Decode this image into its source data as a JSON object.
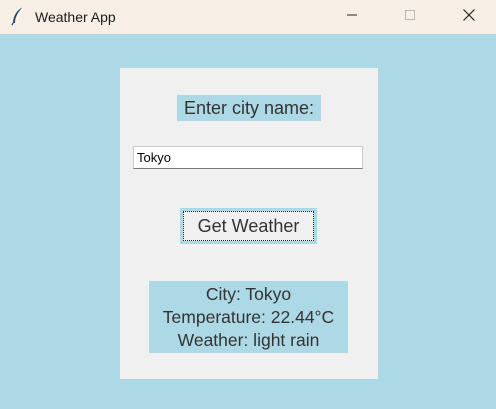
{
  "window": {
    "title": "Weather App",
    "icons": {
      "app": "feather-icon",
      "minimize": "minimize-icon",
      "maximize": "maximize-icon",
      "close": "close-icon"
    }
  },
  "form": {
    "city_label": "Enter city name:",
    "city_value": "Tokyo",
    "button_label": "Get Weather"
  },
  "result": {
    "city_line": "City: Tokyo",
    "temperature_line": "Temperature: 22.44°C",
    "weather_line": "Weather: light rain"
  },
  "colors": {
    "background": "#add8e6",
    "panel": "#f0f0f0",
    "titlebar": "#f7efe6",
    "text": "#333333"
  }
}
